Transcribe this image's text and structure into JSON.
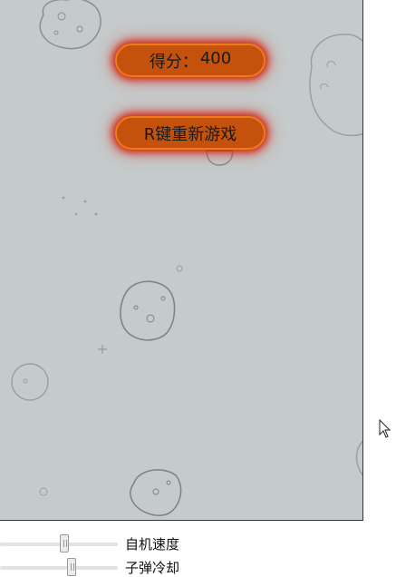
{
  "hud": {
    "score_label": "得分：",
    "score_value": "400",
    "restart_label": "R键重新游戏"
  },
  "controls": {
    "speed_label": "自机速度",
    "speed_value": 0.55,
    "cooldown_label": "子弹冷却",
    "cooldown_value": 0.62
  },
  "colors": {
    "canvas_bg": "#c5cacb",
    "pill_fill": "#c4520c",
    "pill_border": "#f07a18",
    "pill_glow": "#d21e0a"
  },
  "icons": [
    "asteroid-icon",
    "mouse-cursor-icon"
  ]
}
